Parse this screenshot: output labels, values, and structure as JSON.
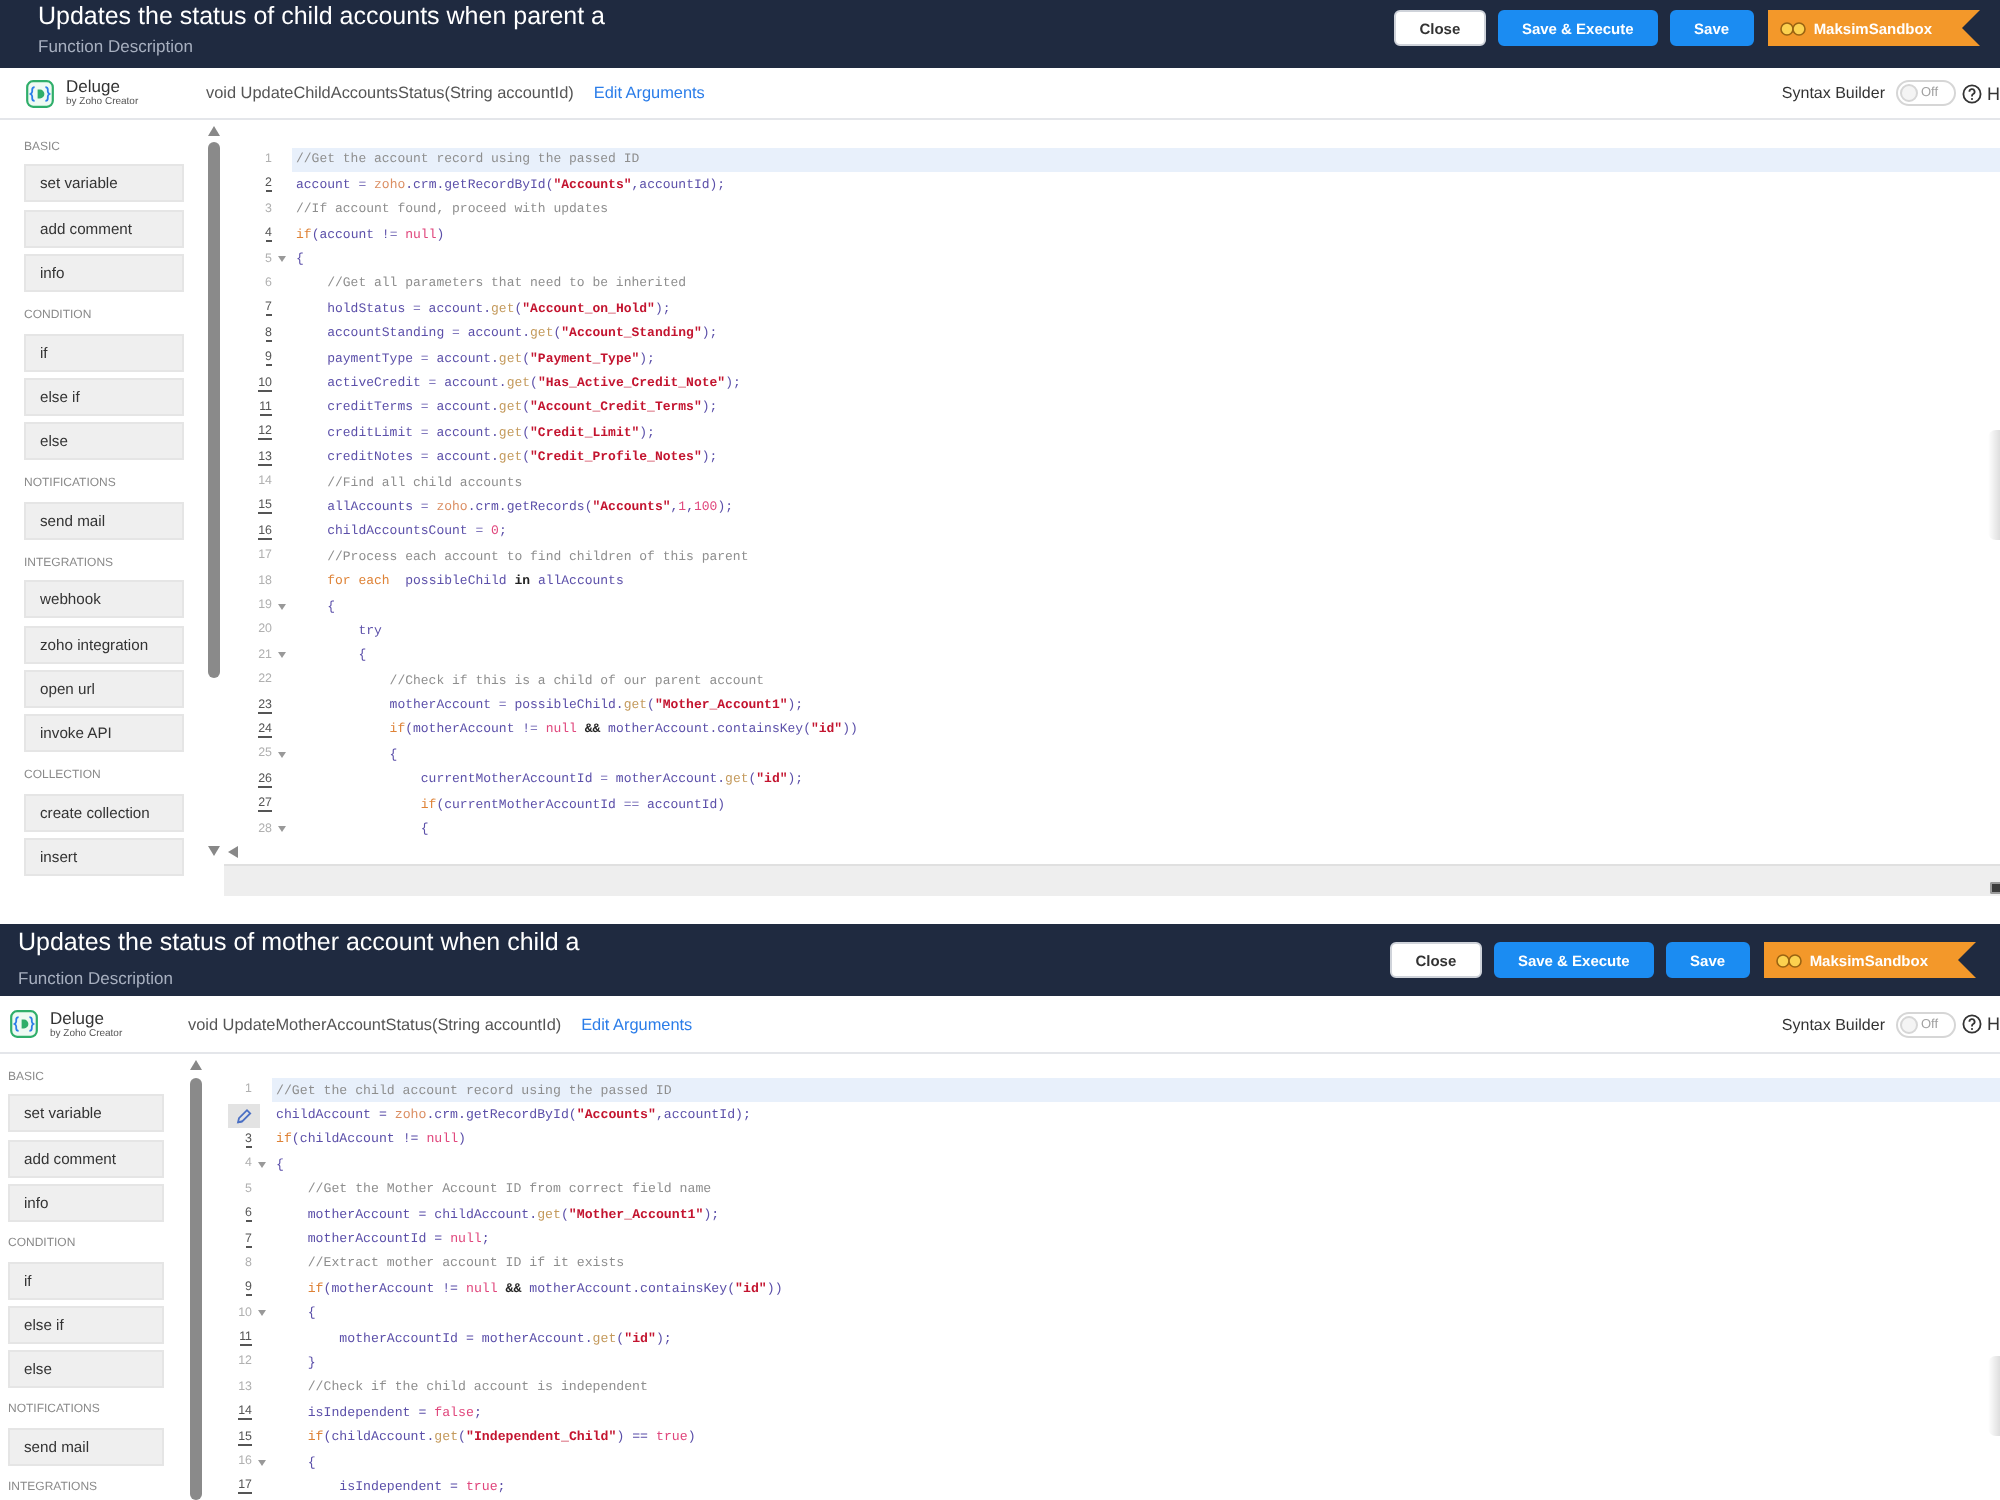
{
  "panels": [
    {
      "title": "Updates the status of child accounts when parent a",
      "description": "Function Description",
      "buttons": [
        {
          "label": "Close",
          "kind": "secondary"
        },
        {
          "label": "Save & Execute",
          "kind": "primary"
        },
        {
          "label": "Save",
          "kind": "primary"
        }
      ],
      "environment": {
        "label": "MaksimSandbox"
      },
      "toolbar": {
        "logo_name": "Deluge",
        "logo_tagline": "by Zoho Creator",
        "signature": "void UpdateChildAccountsStatus(String accountId)",
        "edit_link": "Edit Arguments",
        "syntax_builder": {
          "label": "Syntax Builder",
          "toggle_label": "Off",
          "on": false
        },
        "help_label": "H"
      },
      "sidebar": [
        {
          "heading": "BASIC",
          "items": [
            "set variable",
            "add comment",
            "info"
          ]
        },
        {
          "heading": "CONDITION",
          "items": [
            "if",
            "else if",
            "else"
          ]
        },
        {
          "heading": "NOTIFICATIONS",
          "items": [
            "send mail"
          ]
        },
        {
          "heading": "INTEGRATIONS",
          "items": [
            "webhook",
            "zoho integration",
            "open url",
            "invoke API"
          ]
        },
        {
          "heading": "COLLECTION",
          "items": [
            "create collection",
            "insert"
          ]
        }
      ],
      "code_lines": [
        {
          "number": "1",
          "active": true,
          "underlined": false,
          "fold": false,
          "editing": false,
          "tokens": [
            {
              "kind": "comment",
              "text": "//Get the account record using the passed ID"
            }
          ]
        },
        {
          "number": "2",
          "active": false,
          "underlined": true,
          "fold": false,
          "editing": false,
          "tokens": [
            {
              "kind": "code",
              "text": "account = "
            },
            {
              "kind": "builtin",
              "text": "zoho"
            },
            {
              "kind": "code",
              "text": ".crm.getRecordById("
            },
            {
              "kind": "string",
              "text": "\"Accounts\""
            },
            {
              "kind": "code",
              "text": ",accountId);"
            }
          ]
        },
        {
          "number": "3",
          "active": false,
          "underlined": false,
          "fold": false,
          "editing": false,
          "tokens": [
            {
              "kind": "comment",
              "text": "//If account found, proceed with updates"
            }
          ]
        },
        {
          "number": "4",
          "active": false,
          "underlined": true,
          "fold": false,
          "editing": false,
          "tokens": [
            {
              "kind": "keyword",
              "text": "if"
            },
            {
              "kind": "code",
              "text": "(account != "
            },
            {
              "kind": "literal",
              "text": "null"
            },
            {
              "kind": "code",
              "text": ")"
            }
          ]
        },
        {
          "number": "5",
          "active": false,
          "underlined": false,
          "fold": true,
          "editing": false,
          "tokens": [
            {
              "kind": "code",
              "text": "{"
            }
          ]
        },
        {
          "number": "6",
          "active": false,
          "underlined": false,
          "fold": false,
          "editing": false,
          "tokens": [
            {
              "kind": "comment",
              "text": "    //Get all parameters that need to be inherited"
            }
          ]
        },
        {
          "number": "7",
          "active": false,
          "underlined": true,
          "fold": false,
          "editing": false,
          "tokens": [
            {
              "kind": "code",
              "text": "    holdStatus = account."
            },
            {
              "kind": "method",
              "text": "get"
            },
            {
              "kind": "code",
              "text": "("
            },
            {
              "kind": "string",
              "text": "\"Account_on_Hold\""
            },
            {
              "kind": "code",
              "text": ");"
            }
          ]
        },
        {
          "number": "8",
          "active": false,
          "underlined": true,
          "fold": false,
          "editing": false,
          "tokens": [
            {
              "kind": "code",
              "text": "    accountStanding = account."
            },
            {
              "kind": "method",
              "text": "get"
            },
            {
              "kind": "code",
              "text": "("
            },
            {
              "kind": "string",
              "text": "\"Account_Standing\""
            },
            {
              "kind": "code",
              "text": ");"
            }
          ]
        },
        {
          "number": "9",
          "active": false,
          "underlined": true,
          "fold": false,
          "editing": false,
          "tokens": [
            {
              "kind": "code",
              "text": "    paymentType = account."
            },
            {
              "kind": "method",
              "text": "get"
            },
            {
              "kind": "code",
              "text": "("
            },
            {
              "kind": "string",
              "text": "\"Payment_Type\""
            },
            {
              "kind": "code",
              "text": ");"
            }
          ]
        },
        {
          "number": "10",
          "active": false,
          "underlined": true,
          "fold": false,
          "editing": false,
          "tokens": [
            {
              "kind": "code",
              "text": "    activeCredit = account."
            },
            {
              "kind": "method",
              "text": "get"
            },
            {
              "kind": "code",
              "text": "("
            },
            {
              "kind": "string",
              "text": "\"Has_Active_Credit_Note\""
            },
            {
              "kind": "code",
              "text": ");"
            }
          ]
        },
        {
          "number": "11",
          "active": false,
          "underlined": true,
          "fold": false,
          "editing": false,
          "tokens": [
            {
              "kind": "code",
              "text": "    creditTerms = account."
            },
            {
              "kind": "method",
              "text": "get"
            },
            {
              "kind": "code",
              "text": "("
            },
            {
              "kind": "string",
              "text": "\"Account_Credit_Terms\""
            },
            {
              "kind": "code",
              "text": ");"
            }
          ]
        },
        {
          "number": "12",
          "active": false,
          "underlined": true,
          "fold": false,
          "editing": false,
          "tokens": [
            {
              "kind": "code",
              "text": "    creditLimit = account."
            },
            {
              "kind": "method",
              "text": "get"
            },
            {
              "kind": "code",
              "text": "("
            },
            {
              "kind": "string",
              "text": "\"Credit_Limit\""
            },
            {
              "kind": "code",
              "text": ");"
            }
          ]
        },
        {
          "number": "13",
          "active": false,
          "underlined": true,
          "fold": false,
          "editing": false,
          "tokens": [
            {
              "kind": "code",
              "text": "    creditNotes = account."
            },
            {
              "kind": "method",
              "text": "get"
            },
            {
              "kind": "code",
              "text": "("
            },
            {
              "kind": "string",
              "text": "\"Credit_Profile_Notes\""
            },
            {
              "kind": "code",
              "text": ");"
            }
          ]
        },
        {
          "number": "14",
          "active": false,
          "underlined": false,
          "fold": false,
          "editing": false,
          "tokens": [
            {
              "kind": "comment",
              "text": "    //Find all child accounts"
            }
          ]
        },
        {
          "number": "15",
          "active": false,
          "underlined": true,
          "fold": false,
          "editing": false,
          "tokens": [
            {
              "kind": "code",
              "text": "    allAccounts = "
            },
            {
              "kind": "builtin",
              "text": "zoho"
            },
            {
              "kind": "code",
              "text": ".crm.getRecords("
            },
            {
              "kind": "string",
              "text": "\"Accounts\""
            },
            {
              "kind": "code",
              "text": ","
            },
            {
              "kind": "literal",
              "text": "1"
            },
            {
              "kind": "code",
              "text": ","
            },
            {
              "kind": "literal",
              "text": "100"
            },
            {
              "kind": "code",
              "text": ");"
            }
          ]
        },
        {
          "number": "16",
          "active": false,
          "underlined": true,
          "fold": false,
          "editing": false,
          "tokens": [
            {
              "kind": "code",
              "text": "    childAccountsCount = "
            },
            {
              "kind": "literal",
              "text": "0"
            },
            {
              "kind": "code",
              "text": ";"
            }
          ]
        },
        {
          "number": "17",
          "active": false,
          "underlined": false,
          "fold": false,
          "editing": false,
          "tokens": [
            {
              "kind": "comment",
              "text": "    //Process each account to find children of this parent"
            }
          ]
        },
        {
          "number": "18",
          "active": false,
          "underlined": false,
          "fold": false,
          "editing": false,
          "tokens": [
            {
              "kind": "keyword",
              "text": "    for each"
            },
            {
              "kind": "code",
              "text": "  possibleChild "
            },
            {
              "kind": "strong",
              "text": "in"
            },
            {
              "kind": "code",
              "text": " allAccounts"
            }
          ]
        },
        {
          "number": "19",
          "active": false,
          "underlined": false,
          "fold": true,
          "editing": false,
          "tokens": [
            {
              "kind": "code",
              "text": "    {"
            }
          ]
        },
        {
          "number": "20",
          "active": false,
          "underlined": false,
          "fold": false,
          "editing": false,
          "tokens": [
            {
              "kind": "code",
              "text": "        try"
            }
          ]
        },
        {
          "number": "21",
          "active": false,
          "underlined": false,
          "fold": true,
          "editing": false,
          "tokens": [
            {
              "kind": "code",
              "text": "        {"
            }
          ]
        },
        {
          "number": "22",
          "active": false,
          "underlined": false,
          "fold": false,
          "editing": false,
          "tokens": [
            {
              "kind": "comment",
              "text": "            //Check if this is a child of our parent account"
            }
          ]
        },
        {
          "number": "23",
          "active": false,
          "underlined": true,
          "fold": false,
          "editing": false,
          "tokens": [
            {
              "kind": "code",
              "text": "            motherAccount = possibleChild."
            },
            {
              "kind": "method",
              "text": "get"
            },
            {
              "kind": "code",
              "text": "("
            },
            {
              "kind": "string",
              "text": "\"Mother_Account1\""
            },
            {
              "kind": "code",
              "text": ");"
            }
          ]
        },
        {
          "number": "24",
          "active": false,
          "underlined": true,
          "fold": false,
          "editing": false,
          "tokens": [
            {
              "kind": "keyword",
              "text": "            if"
            },
            {
              "kind": "code",
              "text": "(motherAccount != "
            },
            {
              "kind": "literal",
              "text": "null"
            },
            {
              "kind": "strong",
              "text": " && "
            },
            {
              "kind": "code",
              "text": "motherAccount.containsKey("
            },
            {
              "kind": "string",
              "text": "\"id\""
            },
            {
              "kind": "code",
              "text": "))"
            }
          ]
        },
        {
          "number": "25",
          "active": false,
          "underlined": false,
          "fold": true,
          "editing": false,
          "tokens": [
            {
              "kind": "code",
              "text": "            {"
            }
          ]
        },
        {
          "number": "26",
          "active": false,
          "underlined": true,
          "fold": false,
          "editing": false,
          "tokens": [
            {
              "kind": "code",
              "text": "                currentMotherAccountId = motherAccount."
            },
            {
              "kind": "method",
              "text": "get"
            },
            {
              "kind": "code",
              "text": "("
            },
            {
              "kind": "string",
              "text": "\"id\""
            },
            {
              "kind": "code",
              "text": ");"
            }
          ]
        },
        {
          "number": "27",
          "active": false,
          "underlined": true,
          "fold": false,
          "editing": false,
          "tokens": [
            {
              "kind": "keyword",
              "text": "                if"
            },
            {
              "kind": "code",
              "text": "(currentMotherAccountId == accountId)"
            }
          ]
        },
        {
          "number": "28",
          "active": false,
          "underlined": false,
          "fold": true,
          "editing": false,
          "tokens": [
            {
              "kind": "code",
              "text": "                {"
            }
          ]
        }
      ]
    },
    {
      "title": "Updates the status of mother account when child a",
      "description": "Function Description",
      "buttons": [
        {
          "label": "Close",
          "kind": "secondary"
        },
        {
          "label": "Save & Execute",
          "kind": "primary"
        },
        {
          "label": "Save",
          "kind": "primary"
        }
      ],
      "environment": {
        "label": "MaksimSandbox"
      },
      "toolbar": {
        "logo_name": "Deluge",
        "logo_tagline": "by Zoho Creator",
        "signature": "void UpdateMotherAccountStatus(String accountId)",
        "edit_link": "Edit Arguments",
        "syntax_builder": {
          "label": "Syntax Builder",
          "toggle_label": "Off",
          "on": false
        },
        "help_label": "H"
      },
      "sidebar": [
        {
          "heading": "BASIC",
          "items": [
            "set variable",
            "add comment",
            "info"
          ]
        },
        {
          "heading": "CONDITION",
          "items": [
            "if",
            "else if",
            "else"
          ]
        },
        {
          "heading": "NOTIFICATIONS",
          "items": [
            "send mail"
          ]
        },
        {
          "heading": "INTEGRATIONS"
        }
      ],
      "code_lines": [
        {
          "number": "1",
          "active": true,
          "underlined": false,
          "fold": false,
          "editing": false,
          "tokens": [
            {
              "kind": "comment",
              "text": "//Get the child account record using the passed ID"
            }
          ]
        },
        {
          "active": false,
          "fold": false,
          "editing": true,
          "tokens": [
            {
              "kind": "code",
              "text": "childAccount = "
            },
            {
              "kind": "builtin",
              "text": "zoho"
            },
            {
              "kind": "code",
              "text": ".crm.getRecordById("
            },
            {
              "kind": "string",
              "text": "\"Accounts\""
            },
            {
              "kind": "code",
              "text": ",accountId);"
            }
          ]
        },
        {
          "number": "3",
          "active": false,
          "underlined": true,
          "fold": false,
          "editing": false,
          "tokens": [
            {
              "kind": "keyword",
              "text": "if"
            },
            {
              "kind": "code",
              "text": "(childAccount != "
            },
            {
              "kind": "literal",
              "text": "null"
            },
            {
              "kind": "code",
              "text": ")"
            }
          ]
        },
        {
          "number": "4",
          "active": false,
          "underlined": false,
          "fold": true,
          "editing": false,
          "tokens": [
            {
              "kind": "code",
              "text": "{"
            }
          ]
        },
        {
          "number": "5",
          "active": false,
          "underlined": false,
          "fold": false,
          "editing": false,
          "tokens": [
            {
              "kind": "comment",
              "text": "    //Get the Mother Account ID from correct field name"
            }
          ]
        },
        {
          "number": "6",
          "active": false,
          "underlined": true,
          "fold": false,
          "editing": false,
          "tokens": [
            {
              "kind": "code",
              "text": "    motherAccount = childAccount."
            },
            {
              "kind": "method",
              "text": "get"
            },
            {
              "kind": "code",
              "text": "("
            },
            {
              "kind": "string",
              "text": "\"Mother_Account1\""
            },
            {
              "kind": "code",
              "text": ");"
            }
          ]
        },
        {
          "number": "7",
          "active": false,
          "underlined": true,
          "fold": false,
          "editing": false,
          "tokens": [
            {
              "kind": "code",
              "text": "    motherAccountId = "
            },
            {
              "kind": "literal",
              "text": "null"
            },
            {
              "kind": "code",
              "text": ";"
            }
          ]
        },
        {
          "number": "8",
          "active": false,
          "underlined": false,
          "fold": false,
          "editing": false,
          "tokens": [
            {
              "kind": "comment",
              "text": "    //Extract mother account ID if it exists"
            }
          ]
        },
        {
          "number": "9",
          "active": false,
          "underlined": true,
          "fold": false,
          "editing": false,
          "tokens": [
            {
              "kind": "keyword",
              "text": "    if"
            },
            {
              "kind": "code",
              "text": "(motherAccount != "
            },
            {
              "kind": "literal",
              "text": "null"
            },
            {
              "kind": "strong",
              "text": " && "
            },
            {
              "kind": "code",
              "text": "motherAccount.containsKey("
            },
            {
              "kind": "string",
              "text": "\"id\""
            },
            {
              "kind": "code",
              "text": "))"
            }
          ]
        },
        {
          "number": "10",
          "active": false,
          "underlined": false,
          "fold": true,
          "editing": false,
          "tokens": [
            {
              "kind": "code",
              "text": "    {"
            }
          ]
        },
        {
          "number": "11",
          "active": false,
          "underlined": true,
          "fold": false,
          "editing": false,
          "tokens": [
            {
              "kind": "code",
              "text": "        motherAccountId = motherAccount."
            },
            {
              "kind": "method",
              "text": "get"
            },
            {
              "kind": "code",
              "text": "("
            },
            {
              "kind": "string",
              "text": "\"id\""
            },
            {
              "kind": "code",
              "text": ");"
            }
          ]
        },
        {
          "number": "12",
          "active": false,
          "underlined": false,
          "fold": false,
          "editing": false,
          "tokens": [
            {
              "kind": "code",
              "text": "    }"
            }
          ]
        },
        {
          "number": "13",
          "active": false,
          "underlined": false,
          "fold": false,
          "editing": false,
          "tokens": [
            {
              "kind": "comment",
              "text": "    //Check if the child account is independent"
            }
          ]
        },
        {
          "number": "14",
          "active": false,
          "underlined": true,
          "fold": false,
          "editing": false,
          "tokens": [
            {
              "kind": "code",
              "text": "    isIndependent = "
            },
            {
              "kind": "literal",
              "text": "false"
            },
            {
              "kind": "code",
              "text": ";"
            }
          ]
        },
        {
          "number": "15",
          "active": false,
          "underlined": true,
          "fold": false,
          "editing": false,
          "tokens": [
            {
              "kind": "keyword",
              "text": "    if"
            },
            {
              "kind": "code",
              "text": "(childAccount."
            },
            {
              "kind": "method",
              "text": "get"
            },
            {
              "kind": "code",
              "text": "("
            },
            {
              "kind": "string",
              "text": "\"Independent_Child\""
            },
            {
              "kind": "code",
              "text": ") == "
            },
            {
              "kind": "literal",
              "text": "true"
            },
            {
              "kind": "code",
              "text": ")"
            }
          ]
        },
        {
          "number": "16",
          "active": false,
          "underlined": false,
          "fold": true,
          "editing": false,
          "tokens": [
            {
              "kind": "code",
              "text": "    {"
            }
          ]
        },
        {
          "number": "17",
          "active": false,
          "underlined": true,
          "fold": false,
          "editing": false,
          "tokens": [
            {
              "kind": "code",
              "text": "        isIndependent = "
            },
            {
              "kind": "literal",
              "text": "true"
            },
            {
              "kind": "code",
              "text": ";"
            }
          ]
        }
      ]
    }
  ]
}
